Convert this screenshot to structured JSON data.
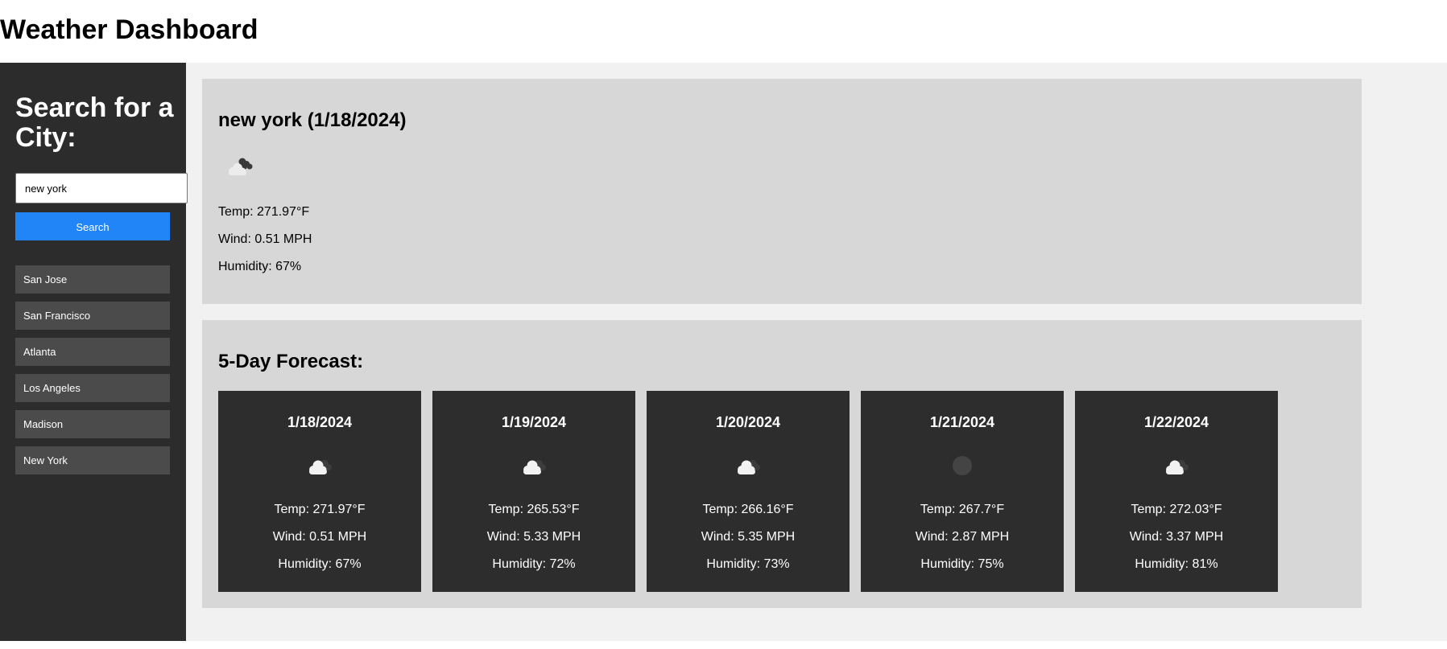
{
  "header": {
    "title": "Weather Dashboard"
  },
  "sidebar": {
    "heading": "Search for a City:",
    "search_value": "new york",
    "search_button": "Search",
    "history": [
      "San Jose",
      "San Francisco",
      "Atlanta",
      "Los Angeles",
      "Madison",
      "New York"
    ]
  },
  "current": {
    "title": "new york (1/18/2024)",
    "icon": "broken-clouds-icon",
    "temp": "Temp: 271.97°F",
    "wind": "Wind: 0.51 MPH",
    "humidity": "Humidity: 67%"
  },
  "forecast": {
    "title": "5-Day Forecast:",
    "days": [
      {
        "date": "1/18/2024",
        "icon": "clouds-icon",
        "temp": "Temp: 271.97°F",
        "wind": "Wind: 0.51 MPH",
        "humidity": "Humidity: 67%"
      },
      {
        "date": "1/19/2024",
        "icon": "clouds-icon",
        "temp": "Temp: 265.53°F",
        "wind": "Wind: 5.33 MPH",
        "humidity": "Humidity: 72%"
      },
      {
        "date": "1/20/2024",
        "icon": "clouds-icon",
        "temp": "Temp: 266.16°F",
        "wind": "Wind: 5.35 MPH",
        "humidity": "Humidity: 73%"
      },
      {
        "date": "1/21/2024",
        "icon": "clear-night-icon",
        "temp": "Temp: 267.7°F",
        "wind": "Wind: 2.87 MPH",
        "humidity": "Humidity: 75%"
      },
      {
        "date": "1/22/2024",
        "icon": "clouds-icon",
        "temp": "Temp: 272.03°F",
        "wind": "Wind: 3.37 MPH",
        "humidity": "Humidity: 81%"
      }
    ]
  },
  "colors": {
    "sidebar_bg": "#2c2c2c",
    "accent": "#2185f8",
    "history_bg": "#4b4b4b",
    "card_bg": "#d7d7d7",
    "day_card_bg": "#2d2d2d",
    "main_bg": "#f1f1f1"
  }
}
